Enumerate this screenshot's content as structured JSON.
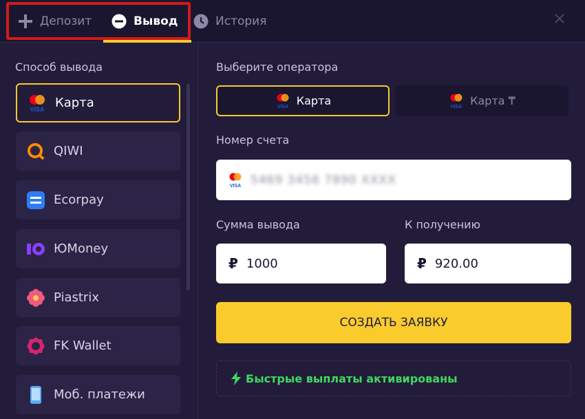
{
  "tabs": {
    "deposit": "Депозит",
    "withdraw": "Вывод",
    "history": "История"
  },
  "left": {
    "title": "Способ вывода",
    "methods": [
      {
        "label": "Карта",
        "icon": "mastercard-visa-icon",
        "active": true
      },
      {
        "label": "QIWI",
        "icon": "qiwi-icon"
      },
      {
        "label": "Ecorpay",
        "icon": "ecorpay-icon"
      },
      {
        "label": "ЮMoney",
        "icon": "yoomoney-icon"
      },
      {
        "label": "Piastrix",
        "icon": "piastrix-icon"
      },
      {
        "label": "FK Wallet",
        "icon": "fk-wallet-icon"
      },
      {
        "label": "Моб. платежи",
        "icon": "mobile-phone-icon"
      }
    ]
  },
  "right": {
    "operator_title": "Выберите оператора",
    "operators": [
      {
        "label": "Карта",
        "active": true
      },
      {
        "label": "Карта ₸",
        "active": false
      }
    ],
    "account_label": "Номер счета",
    "account_value": "5469 3456 7890 XXXX",
    "amount_label": "Сумма вывода",
    "amount_value": "1000",
    "receive_label": "К получению",
    "receive_value": "920.00",
    "currency_symbol": "₽",
    "submit_label": "СОЗДАТЬ ЗАЯВКУ",
    "fast_label": "Быстрые выплаты активированы"
  },
  "colors": {
    "background": "#221c3a",
    "accent": "#f9cb2d",
    "success": "#3fd85e",
    "highlight": "#d01b1b"
  }
}
